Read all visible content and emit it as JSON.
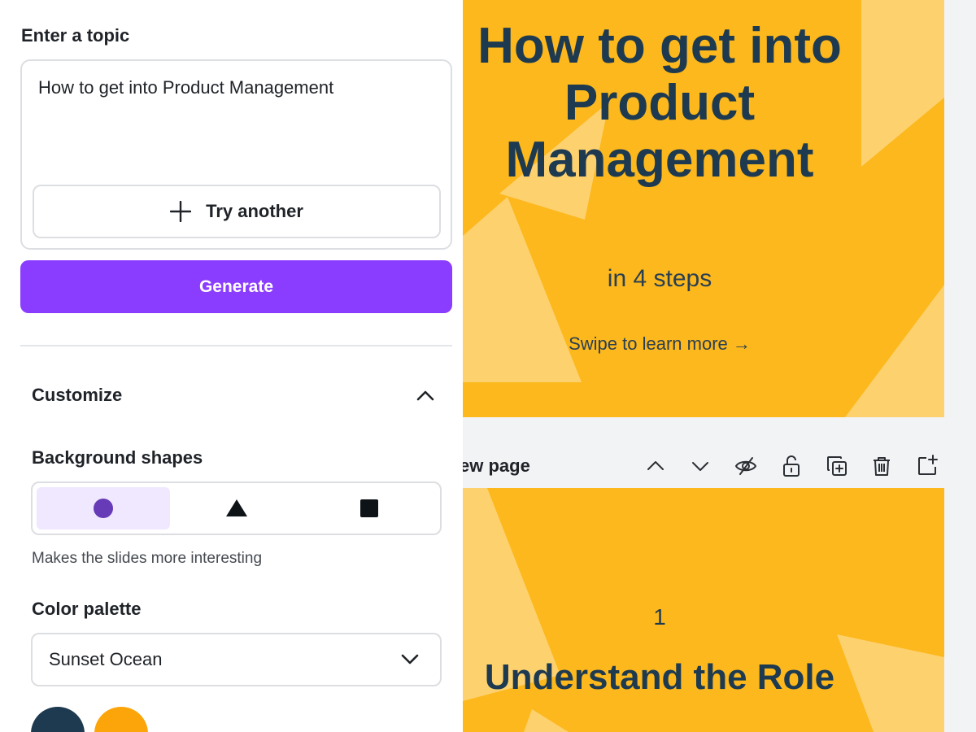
{
  "topic": {
    "heading": "Enter a topic",
    "value": "How to get into Product Management",
    "try_another_label": "Try another"
  },
  "generate_label": "Generate",
  "customize": {
    "heading": "Customize",
    "background_shapes": {
      "heading": "Background shapes",
      "options": [
        "circle",
        "triangle",
        "square"
      ],
      "selected": "circle",
      "hint": "Makes the slides more interesting"
    },
    "color_palette": {
      "heading": "Color palette",
      "selected": "Sunset Ocean",
      "swatches": [
        "#1e3a50",
        "#fca50a"
      ]
    }
  },
  "slides": [
    {
      "title": "How to get into Product Management",
      "subtitle": "in 4 steps",
      "footer": "Swipe to learn more →"
    },
    {
      "number": "1",
      "title": "Understand the Role"
    }
  ],
  "page_toolbar": {
    "label": "ew page",
    "icons": [
      "chevron-up-icon",
      "chevron-down-icon",
      "hide-eye-icon",
      "lock-icon",
      "duplicate-icon",
      "trash-icon",
      "add-page-icon"
    ]
  },
  "colors": {
    "accent": "#8b3dff",
    "slide_background": "#fcb81c",
    "slide_text": "#1e3a50",
    "shape_selected": "#673ab7"
  }
}
